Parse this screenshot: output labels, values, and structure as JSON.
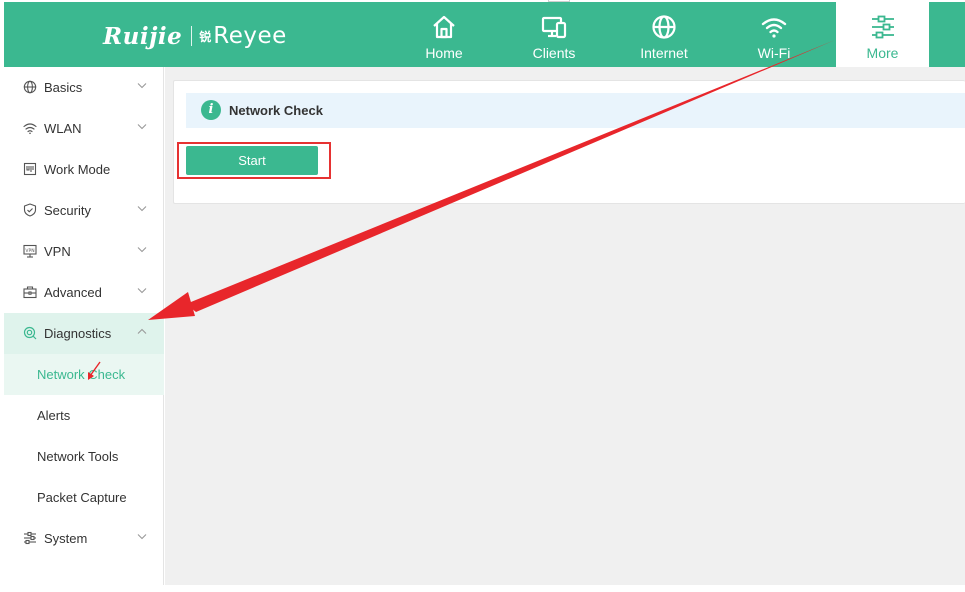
{
  "brand": {
    "logo_primary": "Ruijie",
    "logo_cn": "锐",
    "logo_secondary": "Reyee"
  },
  "header_nav": [
    {
      "label": "Home",
      "icon": "home-icon"
    },
    {
      "label": "Clients",
      "icon": "devices-icon"
    },
    {
      "label": "Internet",
      "icon": "globe-icon"
    },
    {
      "label": "Wi-Fi",
      "icon": "wifi-icon"
    },
    {
      "label": "More",
      "icon": "sliders-icon",
      "active": true
    }
  ],
  "sidebar": {
    "items": [
      {
        "label": "Basics",
        "icon": "globe-icon",
        "expandable": true
      },
      {
        "label": "WLAN",
        "icon": "wifi-icon",
        "expandable": true
      },
      {
        "label": "Work Mode",
        "icon": "work-mode-icon",
        "expandable": false
      },
      {
        "label": "Security",
        "icon": "shield-icon",
        "expandable": true
      },
      {
        "label": "VPN",
        "icon": "vpn-icon",
        "expandable": true
      },
      {
        "label": "Advanced",
        "icon": "toolbox-icon",
        "expandable": true
      },
      {
        "label": "Diagnostics",
        "icon": "diagnostics-icon",
        "expandable": true,
        "open": true
      },
      {
        "label": "System",
        "icon": "system-sliders-icon",
        "expandable": true
      }
    ],
    "diagnostics_sub": [
      {
        "label": "Network Check",
        "active": true
      },
      {
        "label": "Alerts"
      },
      {
        "label": "Network Tools"
      },
      {
        "label": "Packet Capture"
      }
    ]
  },
  "main": {
    "section_title": "Network Check",
    "start_button": "Start"
  },
  "colors": {
    "brand_green": "#3bb890",
    "info_bg": "#e9f4fc",
    "annotation_red": "#e63232"
  }
}
